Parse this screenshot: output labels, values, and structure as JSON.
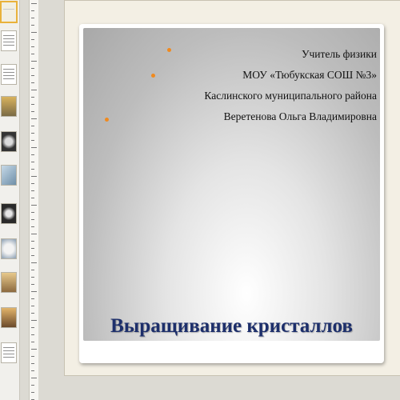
{
  "thumbnails": [
    {
      "type": "title-slide",
      "selected": true
    },
    {
      "type": "text-slide"
    },
    {
      "type": "text-slide"
    },
    {
      "type": "image-slide"
    },
    {
      "type": "image-slide"
    },
    {
      "type": "image-slide"
    },
    {
      "type": "image-slide"
    },
    {
      "type": "image-slide"
    },
    {
      "type": "image-slide"
    },
    {
      "type": "image-slide"
    },
    {
      "type": "text-slide"
    }
  ],
  "slide": {
    "author_lines": [
      "Учитель физики",
      "МОУ «Тюбукская СОШ №3»",
      "Каслинского муниципального района",
      "Веретенова Ольга Владимировна"
    ],
    "title": "Выращивание кристаллов"
  },
  "colors": {
    "bullet": "#f08a1e",
    "title": "#1d2f6b",
    "selected_thumbnail": "#e9b23b"
  },
  "icons": {
    "bullet": "dot-bullet-icon"
  }
}
